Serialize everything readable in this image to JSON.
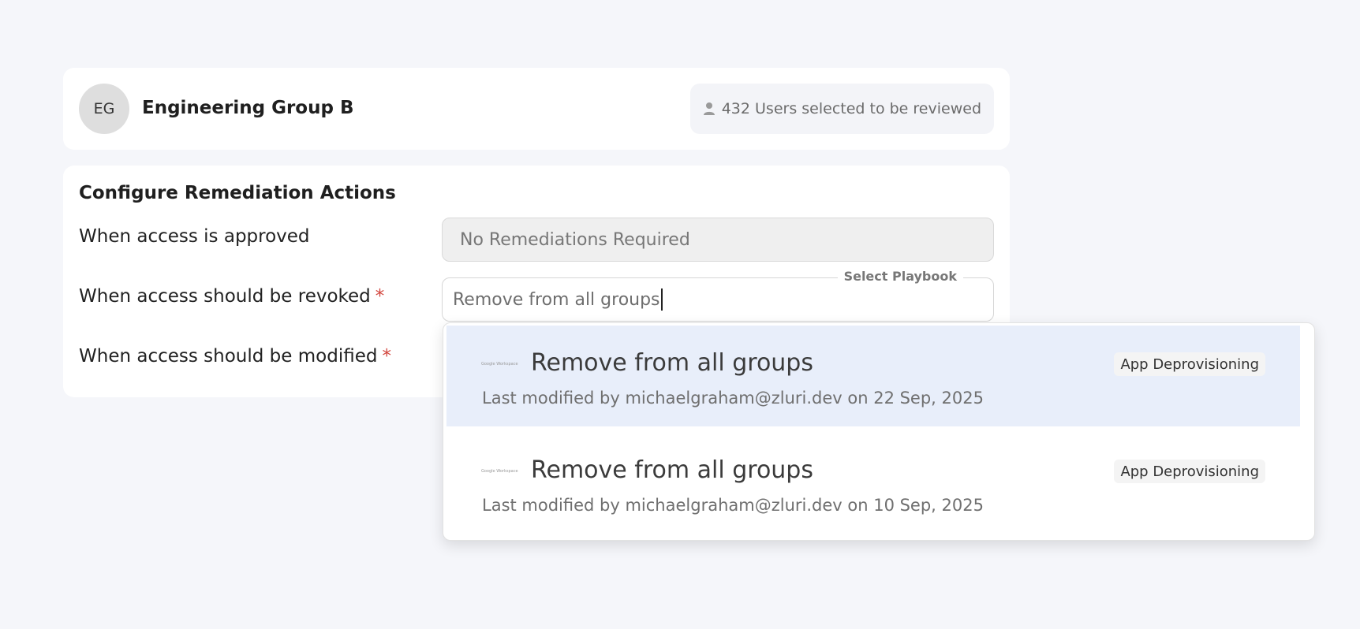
{
  "group": {
    "avatar_initials": "EG",
    "title": "Engineering Group B",
    "users_selected": "432 Users selected to be reviewed"
  },
  "config": {
    "title": "Configure Remediation Actions",
    "approved_label": "When access is approved",
    "approved_value": "No Remediations Required",
    "revoked_label": "When access should be revoked",
    "revoked_value": "Remove from all groups",
    "revoked_float_label": "Select Playbook",
    "modified_label": "When access should be modified",
    "required_mark": "*"
  },
  "dropdown": {
    "options": [
      {
        "logo_text": "Google Workspace",
        "title": "Remove from all groups",
        "subtitle": "Last modified by michaelgraham@zluri.dev on 22 Sep, 2025",
        "badge": "App Deprovisioning"
      },
      {
        "logo_text": "Google Workspace",
        "title": "Remove from all groups",
        "subtitle": "Last modified by michaelgraham@zluri.dev on 10 Sep, 2025",
        "badge": "App Deprovisioning"
      }
    ]
  },
  "colors": {
    "background": "#f5f6fa",
    "highlight": "#e8eefa",
    "required": "#d2453d"
  },
  "icons": {
    "users_pill": "person-icon"
  }
}
